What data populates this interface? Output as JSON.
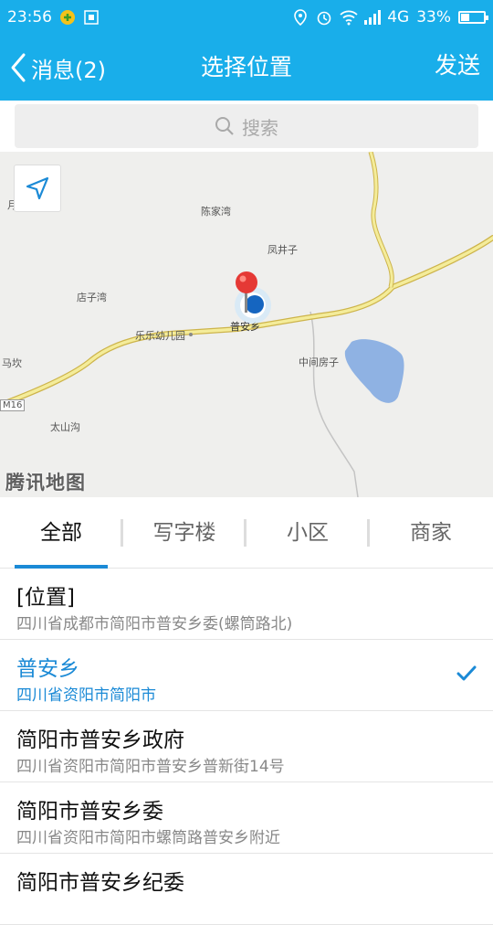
{
  "status_bar": {
    "time": "23:56",
    "network": "4G",
    "battery": "33%",
    "battery_level": 0.33
  },
  "header": {
    "back_label": "消息(2)",
    "title": "选择位置",
    "send_label": "发送"
  },
  "search": {
    "placeholder": "搜索"
  },
  "map": {
    "logo": "腾讯地图",
    "labels": {
      "chenjiawan": "陈家湾",
      "fengjingzi": "凤井子",
      "dianziwan": "店子湾",
      "lelekindergarten": "乐乐幼儿园",
      "puanxiang": "普安乡",
      "zhongjianfangzi": "中间房子",
      "makan": "马坎",
      "taishangou": "太山沟",
      "m16": "M16",
      "yuewan": "月亮湾"
    }
  },
  "tabs": [
    {
      "label": "全部",
      "active": true
    },
    {
      "label": "写字楼",
      "active": false
    },
    {
      "label": "小区",
      "active": false
    },
    {
      "label": "商家",
      "active": false
    }
  ],
  "results": [
    {
      "name": "[位置]",
      "address": "四川省成都市简阳市普安乡委(螺筒路北)",
      "selected": false
    },
    {
      "name": "普安乡",
      "address": "四川省资阳市简阳市",
      "selected": true
    },
    {
      "name": "简阳市普安乡政府",
      "address": "四川省资阳市简阳市普安乡普新街14号",
      "selected": false
    },
    {
      "name": "简阳市普安乡委",
      "address": "四川省资阳市简阳市螺筒路普安乡附近",
      "selected": false
    },
    {
      "name": "简阳市普安乡纪委",
      "address": "",
      "selected": false
    }
  ],
  "colors": {
    "accent": "#19aeea",
    "selected": "#1b8ad6",
    "road": "#f2e27a",
    "water": "#8fb2e3"
  },
  "icons": [
    "back-arrow-icon",
    "search-icon",
    "locate-icon",
    "map-pin-icon",
    "check-icon",
    "location-status-icon",
    "alarm-icon",
    "wifi-icon",
    "signal-icon",
    "battery-icon"
  ]
}
